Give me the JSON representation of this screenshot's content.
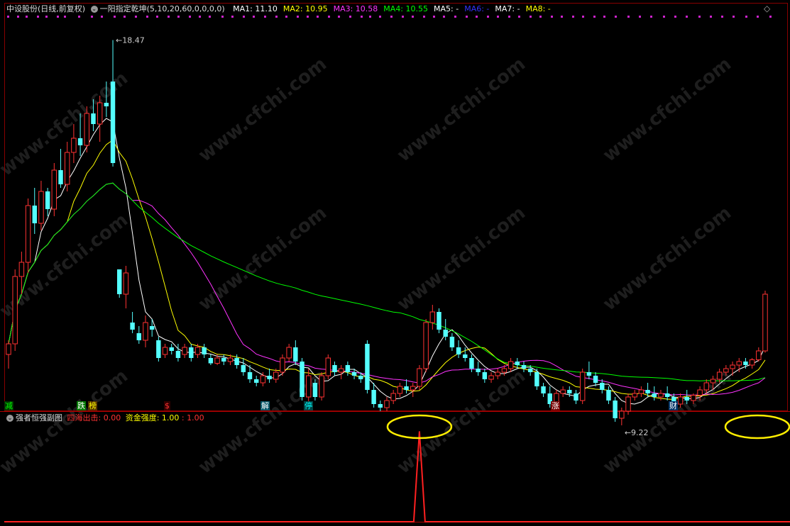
{
  "header": {
    "stock_name": "中设股份",
    "period": "(日线,前复权)",
    "indicator": "一阳指定乾坤",
    "params": "(5,10,20,60,0,0,0,0)",
    "ma": [
      {
        "label": "MA1: 11.10",
        "color": "#ffffff"
      },
      {
        "label": "MA2: 10.95",
        "color": "#ffff00"
      },
      {
        "label": "MA3: 10.58",
        "color": "#ff33ff"
      },
      {
        "label": "MA4: 10.55",
        "color": "#00ff00"
      },
      {
        "label": "MA5: -",
        "color": "#ffffff"
      },
      {
        "label": "MA6: -",
        "color": "#3333ff"
      },
      {
        "label": "MA7: -",
        "color": "#ffffff"
      },
      {
        "label": "MA8: -",
        "color": "#ffff00"
      }
    ],
    "diamond": "◇"
  },
  "sub_header": {
    "title": "强者恒强副图",
    "label1": "四海出击: 0.00",
    "label2": "资金强度: 1.00",
    "label3": ": 1.00"
  },
  "markers": [
    {
      "text": "减",
      "color": "#00ff00",
      "bg": "#003300"
    },
    {
      "text": "跌",
      "color": "#ffffff",
      "bg": "#007700"
    },
    {
      "text": "榜",
      "color": "#ffff00",
      "bg": "#553300"
    },
    {
      "text": "$",
      "color": "#ff3333",
      "bg": "#330000"
    },
    {
      "text": "解",
      "color": "#ffffff",
      "bg": "#005566"
    },
    {
      "text": "停",
      "color": "#00ffff",
      "bg": "#004444"
    },
    {
      "text": "涨",
      "color": "#ffffff",
      "bg": "#770000"
    },
    {
      "text": "财",
      "color": "#ffffff",
      "bg": "#003366"
    }
  ],
  "watermark": "www.cfchi.com",
  "chart_data": {
    "type": "candlestick",
    "high_label": "18.47",
    "low_label": "9.22",
    "ylim": [
      8.5,
      19.0
    ],
    "candles": [
      [
        9.6,
        10.0,
        9.2,
        9.9
      ],
      [
        9.9,
        12.0,
        9.7,
        11.8
      ],
      [
        11.8,
        12.5,
        11.3,
        12.2
      ],
      [
        12.2,
        14.0,
        11.9,
        13.8
      ],
      [
        13.8,
        14.3,
        13.0,
        13.3
      ],
      [
        13.3,
        14.5,
        13.1,
        14.2
      ],
      [
        14.2,
        14.3,
        13.5,
        13.7
      ],
      [
        13.7,
        15.0,
        13.5,
        14.8
      ],
      [
        14.8,
        15.4,
        14.3,
        14.4
      ],
      [
        14.4,
        15.6,
        14.2,
        15.3
      ],
      [
        15.3,
        16.1,
        15.0,
        15.7
      ],
      [
        15.7,
        16.4,
        15.2,
        15.5
      ],
      [
        15.5,
        16.6,
        15.3,
        16.4
      ],
      [
        16.4,
        16.8,
        15.9,
        16.1
      ],
      [
        16.1,
        16.9,
        15.6,
        16.7
      ],
      [
        16.7,
        17.3,
        16.3,
        16.6
      ],
      [
        17.3,
        18.47,
        14.9,
        15.0
      ],
      [
        12.0,
        11.8,
        11.2,
        11.3
      ],
      [
        11.3,
        12.1,
        10.9,
        11.9
      ],
      [
        10.5,
        10.8,
        10.2,
        10.3
      ],
      [
        10.2,
        10.4,
        9.9,
        10.0
      ],
      [
        10.0,
        10.7,
        9.8,
        10.5
      ],
      [
        10.4,
        10.6,
        10.1,
        10.3
      ],
      [
        10.0,
        10.1,
        9.4,
        9.5
      ],
      [
        9.6,
        9.9,
        9.5,
        9.8
      ],
      [
        9.8,
        9.9,
        9.6,
        9.7
      ],
      [
        9.7,
        9.9,
        9.4,
        9.5
      ],
      [
        9.6,
        9.9,
        9.5,
        9.8
      ],
      [
        9.8,
        9.9,
        9.4,
        9.5
      ],
      [
        9.6,
        9.9,
        9.5,
        9.8
      ],
      [
        9.8,
        9.9,
        9.5,
        9.6
      ],
      [
        9.5,
        9.6,
        9.3,
        9.35
      ],
      [
        9.35,
        9.6,
        9.3,
        9.5
      ],
      [
        9.5,
        9.6,
        9.3,
        9.4
      ],
      [
        9.4,
        9.6,
        9.3,
        9.5
      ],
      [
        9.5,
        9.6,
        9.2,
        9.3
      ],
      [
        9.3,
        9.5,
        9.0,
        9.1
      ],
      [
        9.1,
        9.3,
        8.8,
        8.9
      ],
      [
        8.9,
        9.0,
        8.7,
        8.8
      ],
      [
        8.8,
        9.1,
        8.7,
        9.0
      ],
      [
        9.0,
        9.2,
        8.8,
        8.9
      ],
      [
        8.9,
        9.2,
        8.8,
        9.1
      ],
      [
        9.1,
        9.6,
        9.0,
        9.5
      ],
      [
        9.5,
        9.9,
        9.4,
        9.8
      ],
      [
        9.8,
        10.0,
        9.3,
        9.4
      ],
      [
        9.4,
        9.5,
        8.3,
        8.4
      ],
      [
        8.4,
        9.2,
        8.2,
        9.0
      ],
      [
        8.8,
        8.9,
        8.3,
        8.4
      ],
      [
        8.4,
        9.1,
        8.3,
        9.0
      ],
      [
        9.0,
        9.6,
        8.9,
        9.5
      ],
      [
        9.3,
        9.4,
        9.0,
        9.1
      ],
      [
        9.1,
        9.3,
        8.9,
        9.2
      ],
      [
        9.3,
        9.4,
        9.0,
        9.1
      ],
      [
        9.1,
        9.2,
        8.9,
        9.0
      ],
      [
        9.0,
        9.1,
        8.8,
        8.9
      ],
      [
        9.9,
        10.0,
        8.5,
        8.6
      ],
      [
        8.6,
        8.8,
        8.1,
        8.2
      ],
      [
        8.2,
        8.3,
        8.0,
        8.1
      ],
      [
        8.1,
        8.4,
        8.0,
        8.3
      ],
      [
        8.3,
        8.6,
        8.2,
        8.5
      ],
      [
        8.5,
        8.8,
        8.4,
        8.7
      ],
      [
        8.7,
        8.9,
        8.5,
        8.6
      ],
      [
        8.6,
        8.8,
        8.4,
        8.7
      ],
      [
        8.7,
        9.3,
        8.6,
        9.2
      ],
      [
        9.2,
        10.6,
        9.1,
        10.5
      ],
      [
        10.5,
        11.0,
        10.3,
        10.8
      ],
      [
        10.8,
        10.9,
        10.2,
        10.3
      ],
      [
        10.3,
        10.6,
        10.0,
        10.1
      ],
      [
        10.1,
        10.2,
        9.7,
        9.8
      ],
      [
        9.8,
        10.0,
        9.5,
        9.6
      ],
      [
        9.6,
        9.8,
        9.4,
        9.5
      ],
      [
        9.5,
        9.6,
        9.1,
        9.2
      ],
      [
        9.2,
        9.4,
        9.0,
        9.1
      ],
      [
        9.1,
        9.2,
        8.8,
        8.9
      ],
      [
        8.9,
        9.1,
        8.8,
        9.0
      ],
      [
        9.0,
        9.2,
        8.9,
        9.1
      ],
      [
        9.1,
        9.3,
        9.0,
        9.2
      ],
      [
        9.2,
        9.5,
        9.1,
        9.4
      ],
      [
        9.4,
        9.5,
        9.2,
        9.3
      ],
      [
        9.3,
        9.4,
        9.1,
        9.2
      ],
      [
        9.2,
        9.3,
        9.0,
        9.1
      ],
      [
        9.1,
        9.2,
        8.6,
        8.7
      ],
      [
        8.7,
        8.8,
        8.4,
        8.5
      ],
      [
        8.5,
        8.7,
        8.1,
        8.2
      ],
      [
        8.2,
        8.6,
        8.1,
        8.5
      ],
      [
        8.5,
        8.7,
        8.4,
        8.6
      ],
      [
        8.6,
        8.7,
        8.4,
        8.5
      ],
      [
        8.5,
        8.6,
        8.2,
        8.3
      ],
      [
        8.3,
        9.2,
        8.2,
        9.1
      ],
      [
        9.1,
        9.4,
        8.9,
        9.0
      ],
      [
        9.0,
        9.1,
        8.7,
        8.8
      ],
      [
        8.8,
        8.9,
        8.5,
        8.6
      ],
      [
        8.6,
        8.7,
        8.2,
        8.3
      ],
      [
        8.3,
        8.4,
        7.7,
        7.8
      ],
      [
        7.8,
        8.1,
        7.6,
        8.0
      ],
      [
        8.0,
        8.5,
        7.9,
        8.4
      ],
      [
        8.4,
        8.6,
        8.3,
        8.5
      ],
      [
        8.5,
        8.7,
        8.4,
        8.6
      ],
      [
        8.6,
        8.8,
        8.4,
        8.5
      ],
      [
        8.5,
        8.7,
        8.3,
        8.4
      ],
      [
        8.4,
        8.6,
        8.3,
        8.5
      ],
      [
        8.5,
        8.7,
        8.3,
        8.4
      ],
      [
        8.4,
        8.5,
        8.1,
        8.2
      ],
      [
        8.2,
        8.5,
        8.1,
        8.4
      ],
      [
        8.4,
        8.6,
        8.2,
        8.3
      ],
      [
        8.3,
        8.5,
        8.2,
        8.45
      ],
      [
        8.45,
        8.7,
        8.3,
        8.6
      ],
      [
        8.6,
        8.9,
        8.5,
        8.8
      ],
      [
        8.8,
        9.0,
        8.6,
        8.9
      ],
      [
        8.9,
        9.2,
        8.8,
        9.1
      ],
      [
        9.1,
        9.3,
        9.0,
        9.2
      ],
      [
        9.2,
        9.4,
        9.0,
        9.3
      ],
      [
        9.3,
        9.5,
        9.1,
        9.4
      ],
      [
        9.4,
        9.5,
        9.2,
        9.3
      ],
      [
        9.3,
        9.5,
        9.2,
        9.45
      ],
      [
        9.45,
        9.8,
        9.4,
        9.7
      ],
      [
        9.7,
        11.4,
        9.65,
        11.3
      ]
    ],
    "sub_series": {
      "name": "四海出击",
      "spikes": [
        {
          "index": 63,
          "value": 1.0
        },
        {
          "index": 126,
          "value": 1.0
        }
      ],
      "ylim": [
        0,
        1.05
      ]
    },
    "annotations": [
      "18.47",
      "9.22"
    ]
  }
}
